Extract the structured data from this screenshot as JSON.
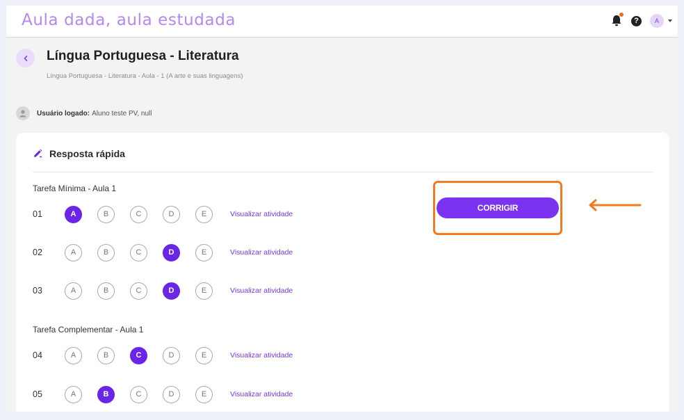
{
  "app": {
    "brand": "Aula dada, aula estudada",
    "avatar_initial": "A"
  },
  "header": {
    "title": "Língua Portuguesa - Literatura",
    "breadcrumb": "Língua Portuguesa - Literatura - Aula - 1 (A arte e suas linguagens)"
  },
  "user": {
    "label": "Usuário logado:",
    "value": "Aluno teste PV, null"
  },
  "card": {
    "title": "Resposta rápida",
    "corrigir_label": "CORRIGIR",
    "view_label": "Visualizar atividade",
    "sections": [
      {
        "title": "Tarefa Mínima - Aula 1",
        "questions": [
          {
            "num": "01",
            "selected": "A"
          },
          {
            "num": "02",
            "selected": "D"
          },
          {
            "num": "03",
            "selected": "D"
          }
        ]
      },
      {
        "title": "Tarefa Complementar - Aula 1",
        "questions": [
          {
            "num": "04",
            "selected": "C"
          },
          {
            "num": "05",
            "selected": "B"
          }
        ]
      }
    ],
    "options": [
      "A",
      "B",
      "C",
      "D",
      "E"
    ]
  },
  "colors": {
    "accent": "#6b25e8",
    "brand": "#b488f2",
    "highlight": "#f37a1f"
  },
  "icons": {
    "notification": "bell-icon",
    "help": "question-circle-icon",
    "back": "chevron-left-icon",
    "user": "user-icon",
    "card": "pencil-icon",
    "annotation": "arrow-left-icon"
  }
}
